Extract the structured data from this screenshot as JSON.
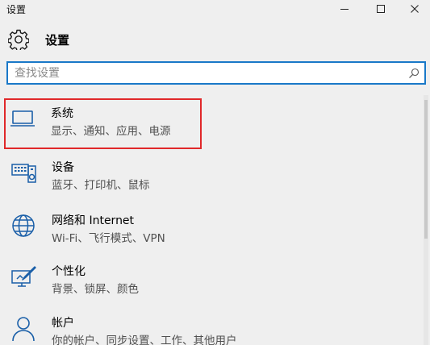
{
  "window": {
    "title": "设置"
  },
  "header": {
    "heading": "设置"
  },
  "search": {
    "placeholder": "查找设置",
    "value": ""
  },
  "categories": [
    {
      "name": "系统",
      "desc": "显示、通知、应用、电源",
      "icon": "laptop-icon",
      "selected": true
    },
    {
      "name": "设备",
      "desc": "蓝牙、打印机、鼠标",
      "icon": "devices-icon",
      "selected": false
    },
    {
      "name": "网络和 Internet",
      "desc": "Wi-Fi、飞行模式、VPN",
      "icon": "globe-icon",
      "selected": false
    },
    {
      "name": "个性化",
      "desc": "背景、锁屏、颜色",
      "icon": "personalization-icon",
      "selected": false
    },
    {
      "name": "帐户",
      "desc": "你的帐户、同步设置、工作、其他用户",
      "icon": "person-icon",
      "selected": false
    }
  ],
  "colors": {
    "accent": "#1978c8",
    "selection_outline": "#e0282a"
  }
}
